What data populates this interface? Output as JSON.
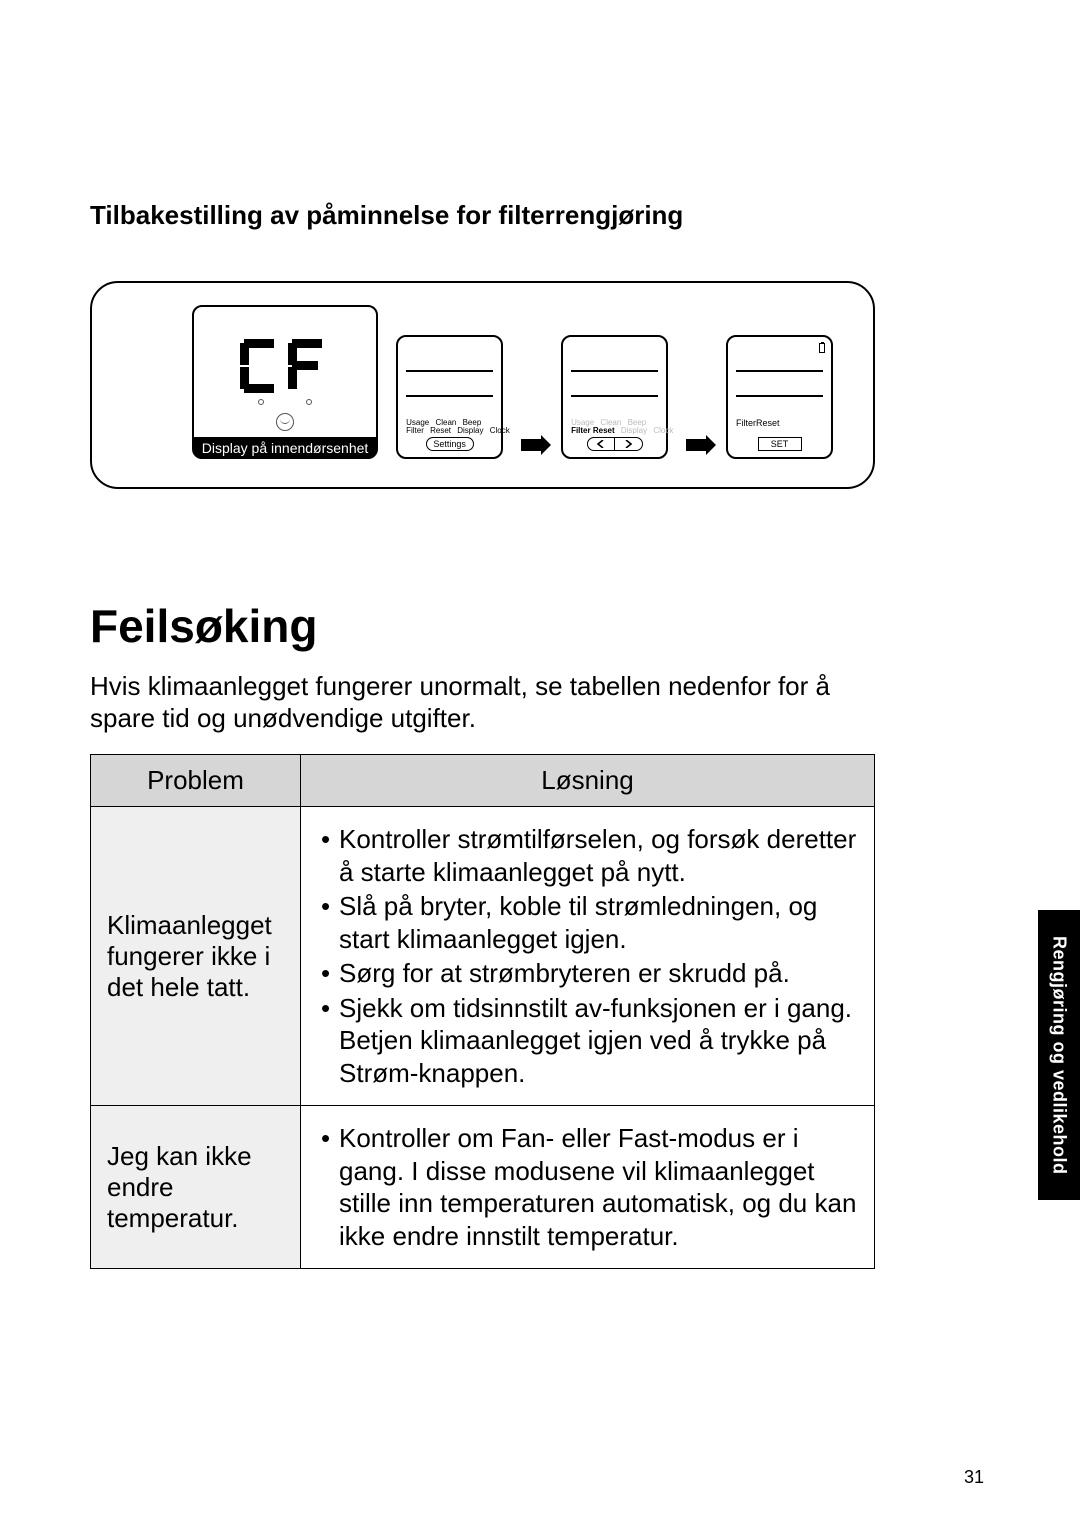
{
  "section_title": "Tilbakestilling av påminnelse for filterrengjøring",
  "diagram": {
    "indoor_caption": "Display på innendørsenhet",
    "labels_row1": [
      "Usage",
      "Clean",
      "Beep"
    ],
    "labels_row2": [
      "Filter",
      "Reset",
      "Display",
      "Clock"
    ],
    "filter_reset_bold": "Filter Reset",
    "settings_btn": "Settings",
    "set_btn": "SET",
    "filter_reset_label": "FilterReset"
  },
  "main_heading": "Feilsøking",
  "intro": "Hvis klimaanlegget fungerer unormalt, se tabellen nedenfor for å spare tid og unødvendige utgifter.",
  "table": {
    "col_problem": "Problem",
    "col_solution": "Løsning",
    "rows": [
      {
        "problem": "Klimaanlegget fungerer ikke i det hele tatt.",
        "solutions": [
          "Kontroller strømtilførselen, og forsøk deretter å starte klimaanlegget på nytt.",
          "Slå på bryter, koble til strømledningen, og start klimaanlegget igjen.",
          "Sørg for at strømbryteren er skrudd på.",
          "Sjekk om tidsinnstilt av-funksjonen er i gang. Betjen klimaanlegget igjen ved å trykke på Strøm-knappen."
        ]
      },
      {
        "problem": "Jeg kan ikke endre temperatur.",
        "solutions": [
          "Kontroller om Fan- eller Fast-modus er i gang. I disse modusene vil klimaanlegget stille inn temperaturen automatisk, og du kan ikke endre innstilt temperatur."
        ]
      }
    ]
  },
  "side_tab": "Rengjøring og vedlikehold",
  "page_number": "31"
}
